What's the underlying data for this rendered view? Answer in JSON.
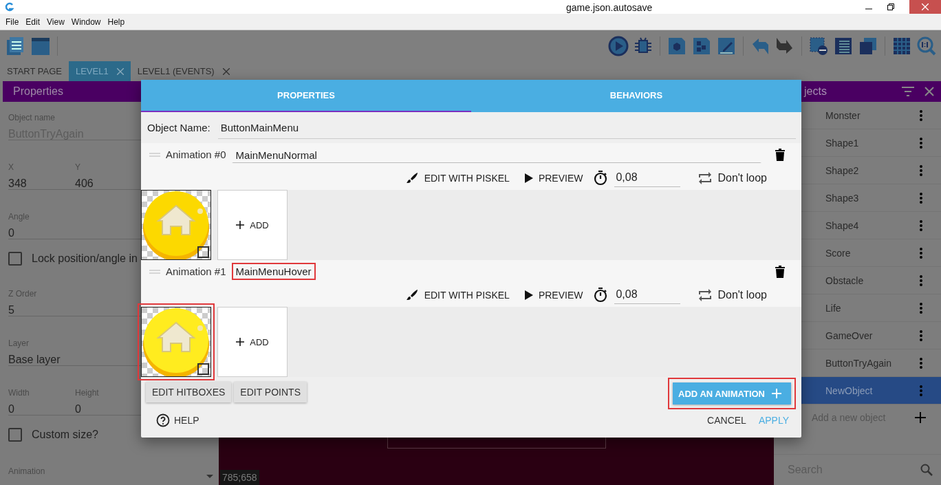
{
  "window": {
    "title": "game.json.autosave"
  },
  "menu": [
    "File",
    "Edit",
    "View",
    "Window",
    "Help"
  ],
  "tabs": [
    {
      "label": "START PAGE",
      "selected": false,
      "closable": false
    },
    {
      "label": "LEVEL1",
      "selected": true,
      "closable": true
    },
    {
      "label": "LEVEL1 (EVENTS)",
      "selected": false,
      "closable": true
    }
  ],
  "properties_panel": {
    "title": "Properties",
    "fields": [
      {
        "kind": "text",
        "label": "Object name",
        "value": "ButtonTryAgain",
        "disabled": true
      },
      {
        "kind": "pair",
        "items": [
          {
            "label": "X",
            "value": "348"
          },
          {
            "label": "Y",
            "value": "406"
          }
        ]
      },
      {
        "kind": "text",
        "label": "Angle",
        "value": "0",
        "disabled": false
      },
      {
        "kind": "checkbox",
        "label": "Lock position/angle in",
        "checked": false
      },
      {
        "kind": "text",
        "label": "Z Order",
        "value": "5",
        "disabled": false
      },
      {
        "kind": "text",
        "label": "Layer",
        "value": "Base layer",
        "disabled": false
      },
      {
        "kind": "pair",
        "items": [
          {
            "label": "Width",
            "value": "0"
          },
          {
            "label": "Height",
            "value": "0"
          }
        ]
      },
      {
        "kind": "checkbox",
        "label": "Custom size?",
        "checked": false
      },
      {
        "kind": "select",
        "label": "Animation"
      }
    ]
  },
  "canvas": {
    "cursor_position": "785;658"
  },
  "objects_panel": {
    "title": "jects",
    "items": [
      {
        "name": "Monster",
        "selected": false
      },
      {
        "name": "Shape1",
        "selected": false
      },
      {
        "name": "Shape2",
        "selected": false
      },
      {
        "name": "Shape3",
        "selected": false
      },
      {
        "name": "Shape4",
        "selected": false
      },
      {
        "name": "Score",
        "selected": false
      },
      {
        "name": "Obstacle",
        "selected": false
      },
      {
        "name": "Life",
        "selected": false
      },
      {
        "name": "GameOver",
        "selected": false
      },
      {
        "name": "ButtonTryAgain",
        "selected": false
      },
      {
        "name": "NewObject",
        "selected": true
      }
    ],
    "add_label": "Add a new object",
    "search_placeholder": "Search"
  },
  "dialog": {
    "tabs": [
      {
        "label": "PROPERTIES",
        "selected": true
      },
      {
        "label": "BEHAVIORS",
        "selected": false
      }
    ],
    "object_name_label": "Object Name:",
    "object_name": "ButtonMainMenu",
    "animations": [
      {
        "label": "Animation #0",
        "name": "MainMenuNormal",
        "name_highlighted": false,
        "edit": "EDIT WITH PISKEL",
        "preview": "PREVIEW",
        "duration": "0,08",
        "loop": "Don't loop",
        "frames": [
          {
            "highlighted": false
          }
        ],
        "add_label": "ADD"
      },
      {
        "label": "Animation #1",
        "name": "MainMenuHover",
        "name_highlighted": true,
        "edit": "EDIT WITH PISKEL",
        "preview": "PREVIEW",
        "duration": "0,08",
        "loop": "Don't loop",
        "frames": [
          {
            "highlighted": true
          }
        ],
        "add_label": "ADD"
      }
    ],
    "edit_hitboxes": "EDIT HITBOXES",
    "edit_points": "EDIT POINTS",
    "add_animation": {
      "label": "ADD AN ANIMATION",
      "highlighted": true
    },
    "help": "HELP",
    "cancel": "CANCEL",
    "apply": "APPLY"
  }
}
